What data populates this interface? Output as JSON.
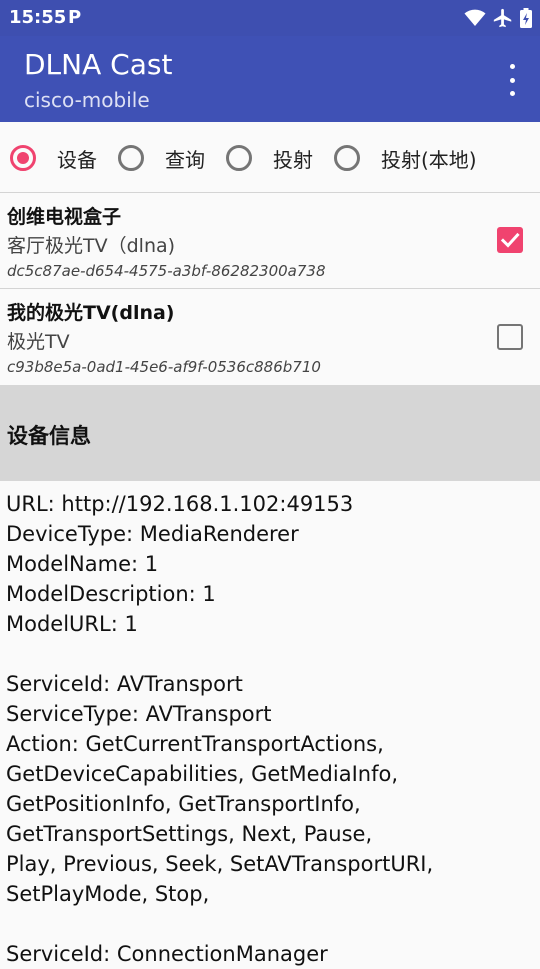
{
  "status_bar": {
    "time": "15:55",
    "notification": "P"
  },
  "app_bar": {
    "title": "DLNA Cast",
    "subtitle": "cisco-mobile"
  },
  "modes": [
    {
      "label": "设备",
      "selected": true
    },
    {
      "label": "查询",
      "selected": false
    },
    {
      "label": "投射",
      "selected": false
    },
    {
      "label": "投射(本地)",
      "selected": false
    }
  ],
  "devices": [
    {
      "name": "创维电视盒子",
      "model": "客厅极光TV（dlna)",
      "uuid": "dc5c87ae-d654-4575-a3bf-86282300a738",
      "checked": true
    },
    {
      "name": "我的极光TV(dlna)",
      "model": "极光TV",
      "uuid": "c93b8e5a-0ad1-45e6-af9f-0536c886b710",
      "checked": false
    }
  ],
  "info": {
    "title": "设备信息",
    "lines": [
      "URL: http://192.168.1.102:49153",
      "DeviceType: MediaRenderer",
      "ModelName: 1",
      "ModelDescription: 1",
      "ModelURL: 1",
      "",
      "ServiceId: AVTransport",
      "ServiceType: AVTransport",
      "Action: GetCurrentTransportActions,",
      "GetDeviceCapabilities, GetMediaInfo,",
      "GetPositionInfo, GetTransportInfo,",
      "GetTransportSettings, Next, Pause,",
      "Play, Previous, Seek, SetAVTransportURI,",
      "SetPlayMode, Stop,",
      "",
      "ServiceId: ConnectionManager"
    ]
  },
  "colors": {
    "status_bar": "#3e4fb0",
    "app_bar": "#3f51b5",
    "accent": "#f0436f",
    "info_header": "#d6d6d6"
  }
}
